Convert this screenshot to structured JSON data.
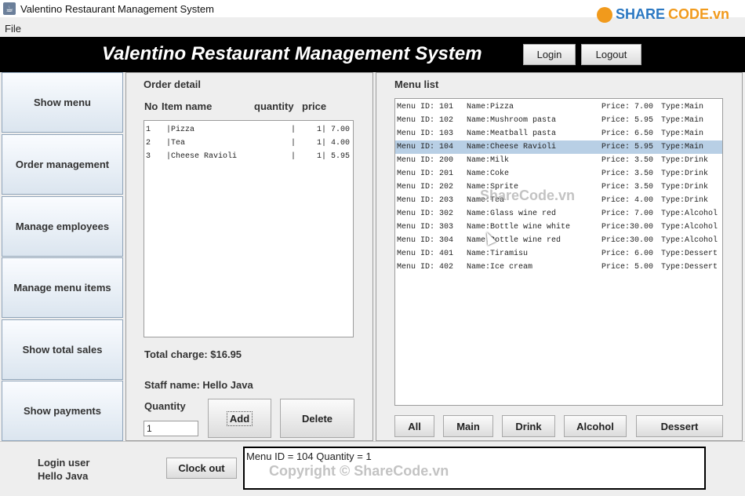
{
  "window": {
    "title": "Valentino Restaurant Management System",
    "controls": [
      "—",
      "□",
      "✕"
    ]
  },
  "watermark": {
    "logo_share": "SHARE",
    "logo_code": "CODE.vn",
    "center": "ShareCode.vn",
    "footer": "Copyright © ShareCode.vn"
  },
  "menubar": {
    "file": "File"
  },
  "header": {
    "title": "Valentino Restaurant Management System",
    "login": "Login",
    "logout": "Logout"
  },
  "sidebar": {
    "items": [
      {
        "label": "Show menu"
      },
      {
        "label": "Order management"
      },
      {
        "label": "Manage employees"
      },
      {
        "label": "Manage menu items"
      },
      {
        "label": "Show total sales"
      },
      {
        "label": "Show payments"
      }
    ]
  },
  "order": {
    "title": "Order detail",
    "columns": {
      "no": "No",
      "item": "Item name",
      "qty": "quantity",
      "price": "price"
    },
    "rows": [
      {
        "no": "1",
        "name": "|Pizza",
        "sep": "|",
        "qty": "1|",
        "price": "7.00"
      },
      {
        "no": "2",
        "name": "|Tea",
        "sep": "|",
        "qty": "1|",
        "price": "4.00"
      },
      {
        "no": "3",
        "name": "|Cheese Ravioli",
        "sep": "|",
        "qty": "1|",
        "price": "5.95"
      }
    ],
    "total": "Total charge: $16.95",
    "staff": "Staff name: Hello Java",
    "quantity_label": "Quantity",
    "quantity_value": "1",
    "add": "Add",
    "delete": "Delete"
  },
  "menu": {
    "title": "Menu list",
    "selected_index": 3,
    "rows": [
      {
        "id": "Menu ID: 101",
        "name": "Name:Pizza",
        "price": "Price: 7.00",
        "type": "Type:Main"
      },
      {
        "id": "Menu ID: 102",
        "name": "Name:Mushroom pasta",
        "price": "Price: 5.95",
        "type": "Type:Main"
      },
      {
        "id": "Menu ID: 103",
        "name": "Name:Meatball pasta",
        "price": "Price: 6.50",
        "type": "Type:Main"
      },
      {
        "id": "Menu ID: 104",
        "name": "Name:Cheese Ravioli",
        "price": "Price: 5.95",
        "type": "Type:Main"
      },
      {
        "id": "Menu ID: 200",
        "name": "Name:Milk",
        "price": "Price: 3.50",
        "type": "Type:Drink"
      },
      {
        "id": "Menu ID: 201",
        "name": "Name:Coke",
        "price": "Price: 3.50",
        "type": "Type:Drink"
      },
      {
        "id": "Menu ID: 202",
        "name": "Name:Sprite",
        "price": "Price: 3.50",
        "type": "Type:Drink"
      },
      {
        "id": "Menu ID: 203",
        "name": "Name:Tea",
        "price": "Price: 4.00",
        "type": "Type:Drink"
      },
      {
        "id": "Menu ID: 302",
        "name": "Name:Glass wine red",
        "price": "Price: 7.00",
        "type": "Type:Alcohol"
      },
      {
        "id": "Menu ID: 303",
        "name": "Name:Bottle wine white",
        "price": "Price:30.00",
        "type": "Type:Alcohol"
      },
      {
        "id": "Menu ID: 304",
        "name": "Name:Bottle wine red",
        "price": "Price:30.00",
        "type": "Type:Alcohol"
      },
      {
        "id": "Menu ID: 401",
        "name": "Name:Tiramisu",
        "price": "Price: 6.00",
        "type": "Type:Dessert"
      },
      {
        "id": "Menu ID: 402",
        "name": "Name:Ice cream",
        "price": "Price: 5.00",
        "type": "Type:Dessert"
      }
    ],
    "filters": {
      "all": "All",
      "main": "Main",
      "drink": "Drink",
      "alcohol": "Alcohol",
      "dessert": "Dessert"
    }
  },
  "status": {
    "login_user_label": "Login user",
    "login_user_name": "Hello Java",
    "clock_out": "Clock out",
    "message": "Menu ID = 104 Quantity = 1"
  }
}
